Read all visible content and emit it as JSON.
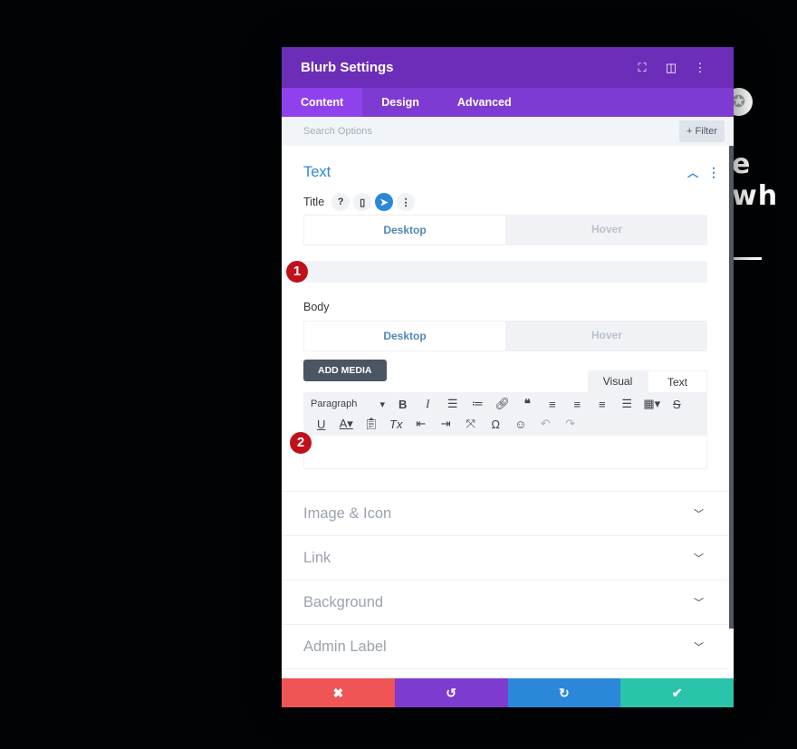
{
  "background": {
    "heading_fragment": "e wh",
    "globe_icon": "globe-icon"
  },
  "modal": {
    "title": "Blurb Settings",
    "header_icons": [
      "fullscreen-icon",
      "split-view-icon",
      "more-options-icon"
    ],
    "tabs": [
      {
        "label": "Content",
        "active": true
      },
      {
        "label": "Design",
        "active": false
      },
      {
        "label": "Advanced",
        "active": false
      }
    ],
    "search": {
      "placeholder": "Search Options",
      "filter_label": "Filter",
      "filter_icon": "+"
    },
    "text_section": {
      "title": "Text",
      "title_field": {
        "label": "Title",
        "icons": [
          "help-icon",
          "mobile-icon",
          "cursor-hover-icon",
          "more-icon"
        ],
        "toggle": {
          "desktop": "Desktop",
          "hover": "Hover"
        },
        "value": "",
        "marker": "1"
      },
      "body_field": {
        "label": "Body",
        "toggle": {
          "desktop": "Desktop",
          "hover": "Hover"
        },
        "add_media": "ADD MEDIA",
        "editor_tabs": {
          "visual": "Visual",
          "text": "Text"
        },
        "format_select": "Paragraph",
        "toolbar_row1": [
          "bold",
          "italic",
          "bullet-list",
          "numbered-list",
          "link",
          "blockquote",
          "align-left",
          "align-center",
          "align-right",
          "justify",
          "table",
          "strikethrough"
        ],
        "toolbar_row2": [
          "underline",
          "text-color",
          "paste-as-text",
          "clear-formatting",
          "outdent",
          "indent",
          "fullscreen",
          "special-character",
          "emoji",
          "undo",
          "redo"
        ],
        "value": "",
        "marker": "2"
      }
    },
    "collapsed_sections": [
      "Image & Icon",
      "Link",
      "Background",
      "Admin Label"
    ],
    "footer": {
      "cancel_color": "#ef5555",
      "undo_color": "#7e3bd0",
      "redo_color": "#2b87da",
      "save_color": "#29c4a9"
    },
    "colors": {
      "header": "#6c2eb9",
      "tabs": "#7d3bd2",
      "active_tab": "#8f42ec",
      "accent_blue": "#2b87da"
    }
  }
}
